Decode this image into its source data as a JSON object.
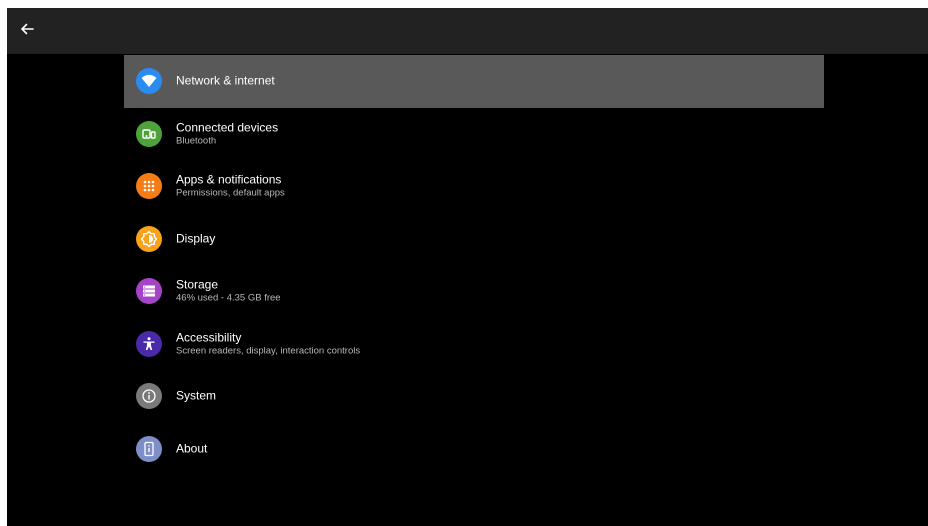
{
  "header": {
    "back_icon": "arrow-left-icon"
  },
  "menu": {
    "items": [
      {
        "title": "Network & internet",
        "subtitle": "",
        "icon": "wifi-icon",
        "color": "#2a8cf0",
        "selected": true
      },
      {
        "title": "Connected devices",
        "subtitle": "Bluetooth",
        "icon": "devices-icon",
        "color": "#4fa23a",
        "selected": false
      },
      {
        "title": "Apps & notifications",
        "subtitle": "Permissions, default apps",
        "icon": "apps-grid-icon",
        "color": "#f57c16",
        "selected": false
      },
      {
        "title": "Display",
        "subtitle": "",
        "icon": "brightness-icon",
        "color": "#f9a21a",
        "selected": false
      },
      {
        "title": "Storage",
        "subtitle": "46% used - 4.35 GB free",
        "icon": "storage-icon",
        "color": "#a544c9",
        "selected": false
      },
      {
        "title": "Accessibility",
        "subtitle": "Screen readers, display, interaction controls",
        "icon": "accessibility-icon",
        "color": "#4b2aa9",
        "selected": false
      },
      {
        "title": "System",
        "subtitle": "",
        "icon": "info-icon",
        "color": "#7a7a7a",
        "selected": false
      },
      {
        "title": "About",
        "subtitle": "",
        "icon": "device-info-icon",
        "color": "#7d8ec8",
        "selected": false
      }
    ]
  }
}
